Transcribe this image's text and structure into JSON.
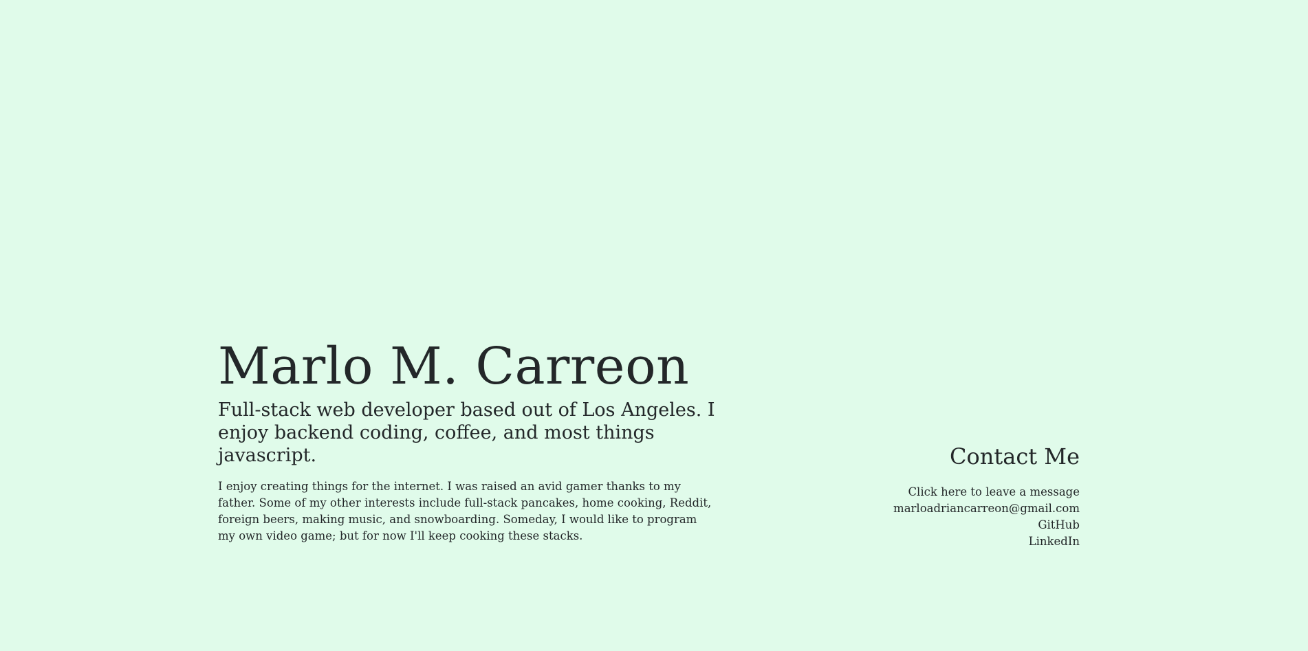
{
  "colors": {
    "background": "#e0fbea",
    "text": "#232729"
  },
  "hero": {
    "name": "Marlo M. Carreon",
    "tagline": "Full-stack web developer based out of Los Angeles. I enjoy backend coding, coffee, and most things javascript.",
    "about": "I enjoy creating things for the internet. I was raised an avid gamer thanks to my father. Some of my other interests include full-stack pancakes, home cooking, Reddit, foreign beers, making music, and snowboarding. Someday, I would like to program my own video game; but for now I'll keep cooking these stacks."
  },
  "contact": {
    "heading": "Contact Me",
    "links": [
      {
        "label": "Click here to leave a message"
      },
      {
        "label": "marloadriancarreon@gmail.com"
      },
      {
        "label": "GitHub"
      },
      {
        "label": "LinkedIn"
      }
    ]
  }
}
